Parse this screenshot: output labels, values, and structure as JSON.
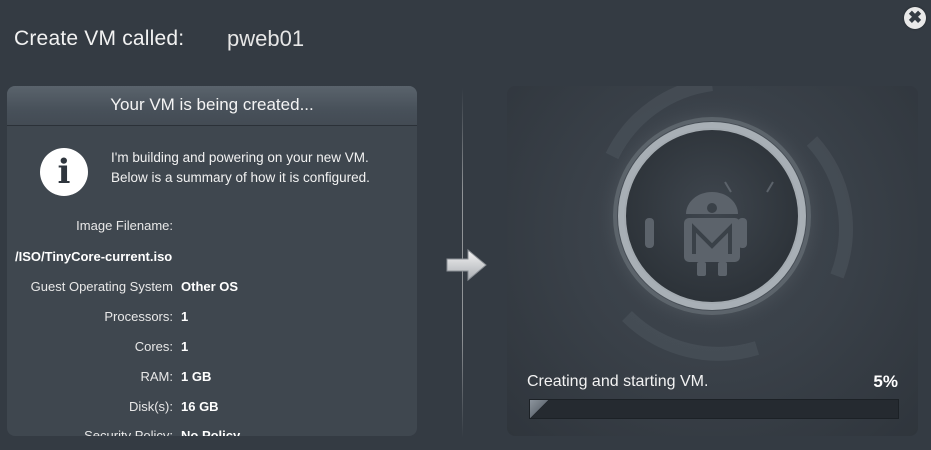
{
  "header": {
    "title": "Create VM called:",
    "vm_name": "pweb01",
    "close_glyph": "✖"
  },
  "summary": {
    "heading": "Your VM is being created...",
    "info_icon": "info-icon",
    "info_glyph": "i",
    "message": "I'm building and powering on your new VM. Below is a summary of how it is configured.",
    "image_filename_label": "Image Filename:",
    "image_filename": "/ISO/TinyCore-current.iso",
    "specs": [
      {
        "label": "Guest Operating System",
        "value": "Other OS"
      },
      {
        "label": "Processors:",
        "value": "1"
      },
      {
        "label": "Cores:",
        "value": "1"
      },
      {
        "label": "RAM:",
        "value": "1 GB"
      },
      {
        "label": "Disk(s):",
        "value": "16 GB"
      },
      {
        "label": "Security Policy:",
        "value": "No Policy"
      }
    ]
  },
  "progress": {
    "status": "Creating and starting VM.",
    "percent_label": "5%",
    "percent_value": 0.05,
    "icon": "robot-logo-icon"
  },
  "colors": {
    "background": "#343b43",
    "panel": "#3f474f",
    "progress_track": "#252a30"
  }
}
